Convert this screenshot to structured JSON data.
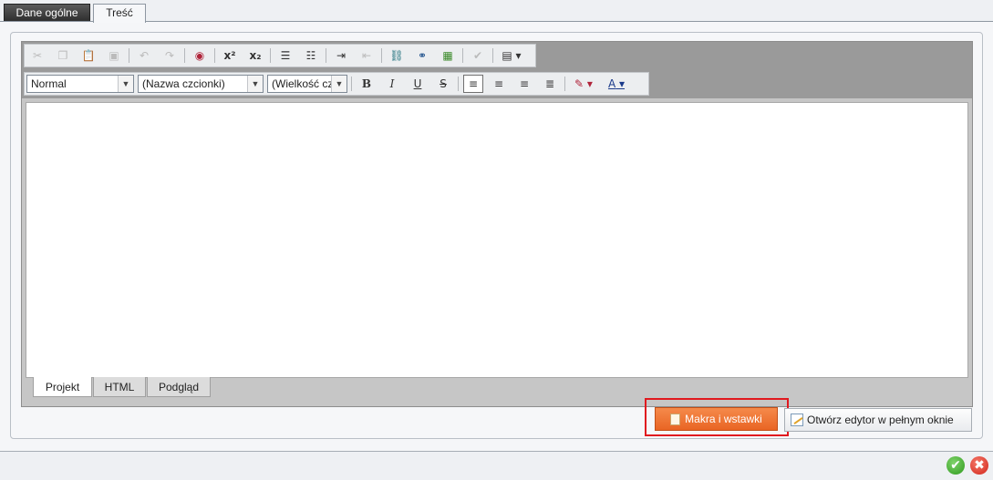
{
  "top_tabs": [
    {
      "label": "Dane ogólne",
      "active": false
    },
    {
      "label": "Treść",
      "active": true
    }
  ],
  "toolbar": {
    "row1": [
      "cut-icon",
      "copy-icon",
      "paste-icon",
      "paste-word-icon",
      "undo-icon",
      "redo-icon",
      "spellcheck-icon",
      "superscript-icon",
      "subscript-icon",
      "ordered-list-icon",
      "unordered-list-icon",
      "indent-icon",
      "outdent-icon",
      "link-icon",
      "unlink-icon",
      "image-icon",
      "check-icon",
      "table-icon"
    ],
    "superscript_label": "x²",
    "subscript_label": "x₂",
    "format_value": "Normal",
    "font_value": "(Nazwa czcionki)",
    "size_value": "(Wielkość cz",
    "bold": "B",
    "italic": "I",
    "underline": "U",
    "strike": "S",
    "font_color_label": "A",
    "accent_color": "#e96524"
  },
  "mode_tabs": [
    {
      "label": "Projekt",
      "active": true
    },
    {
      "label": "HTML",
      "active": false
    },
    {
      "label": "Podgląd",
      "active": false
    }
  ],
  "buttons": {
    "makra": "Makra i wstawki",
    "full_editor": "Otwórz edytor w pełnym oknie"
  }
}
